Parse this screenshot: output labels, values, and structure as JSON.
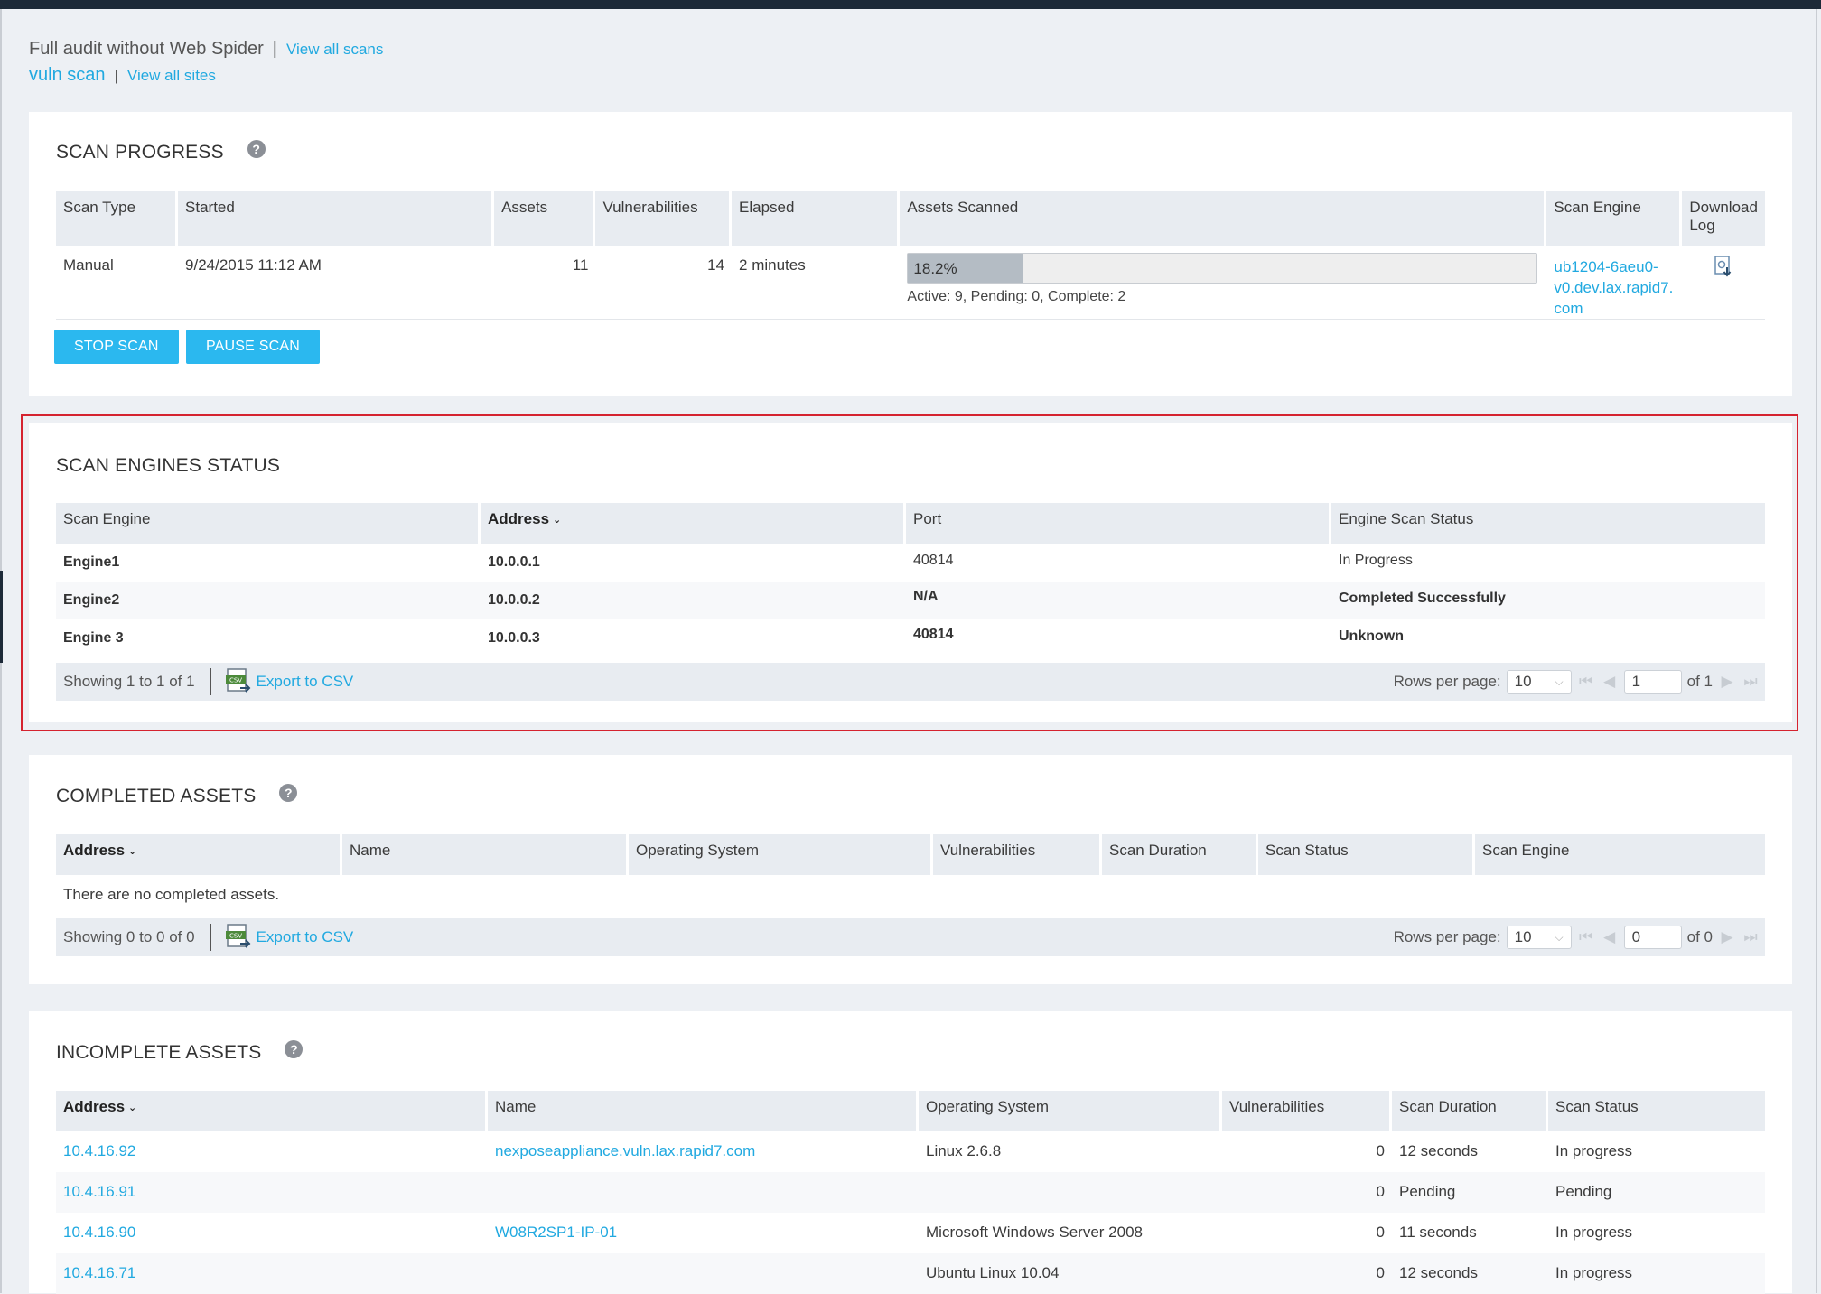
{
  "header": {
    "scan_name": "Full audit without Web Spider",
    "separator": "|",
    "view_all_scans": "View all scans",
    "site_name": "vuln scan",
    "view_all_sites": "View all sites"
  },
  "scan_progress": {
    "title": "SCAN PROGRESS",
    "help": "?",
    "columns": [
      "Scan Type",
      "Started",
      "Assets",
      "Vulnerabilities",
      "Elapsed",
      "Assets Scanned",
      "Scan Engine",
      "Download Log"
    ],
    "row": {
      "scan_type": "Manual",
      "started": "9/24/2015 11:12 AM",
      "assets": "11",
      "vulnerabilities": "14",
      "elapsed": "2 minutes",
      "progress_label": "18.2%",
      "progress_fraction": 0.182,
      "progress_detail": "Active: 9, Pending: 0, Complete: 2",
      "engine_line1": "ub1204-6aeu0-",
      "engine_line2": "v0.dev.lax.rapid7.",
      "engine_line3": "com"
    },
    "stop_label": "STOP SCAN",
    "pause_label": "PAUSE SCAN"
  },
  "engines": {
    "title": "SCAN ENGINES STATUS",
    "columns": [
      "Scan Engine",
      "Address",
      "Port",
      "Engine Scan Status"
    ],
    "rows": [
      {
        "engine": "Engine1",
        "address": "10.0.0.1",
        "port": "40814",
        "status": "In Progress"
      },
      {
        "engine": "Engine2",
        "address": "10.0.0.2",
        "port": "N/A",
        "status": "Completed Successfully"
      },
      {
        "engine": "Engine 3",
        "address": "10.0.0.3",
        "port": "40814",
        "status": "Unknown"
      }
    ],
    "showing": "Showing 1 to 1 of 1",
    "export": "Export to CSV",
    "rows_per_page_label": "Rows per page:",
    "rows_per_page": "10",
    "page": "1",
    "of_pages": "of 1"
  },
  "completed": {
    "title": "COMPLETED ASSETS",
    "help": "?",
    "columns": [
      "Address",
      "Name",
      "Operating System",
      "Vulnerabilities",
      "Scan Duration",
      "Scan Status",
      "Scan Engine"
    ],
    "empty_message": "There are no completed assets.",
    "showing": "Showing 0 to 0 of 0",
    "export": "Export to CSV",
    "rows_per_page_label": "Rows per page:",
    "rows_per_page": "10",
    "page": "0",
    "of_pages": "of 0"
  },
  "incomplete": {
    "title": "INCOMPLETE ASSETS",
    "help": "?",
    "columns": [
      "Address",
      "Name",
      "Operating System",
      "Vulnerabilities",
      "Scan Duration",
      "Scan Status"
    ],
    "rows": [
      {
        "address": "10.4.16.92",
        "name": "nexposeappliance.vuln.lax.rapid7.com",
        "os": "Linux 2.6.8",
        "vulns": "0",
        "duration": "12 seconds",
        "status": "In progress"
      },
      {
        "address": "10.4.16.91",
        "name": "",
        "os": "",
        "vulns": "0",
        "duration": "Pending",
        "status": "Pending"
      },
      {
        "address": "10.4.16.90",
        "name": "W08R2SP1-IP-01",
        "os": "Microsoft Windows Server 2008",
        "vulns": "0",
        "duration": "11 seconds",
        "status": "In progress"
      },
      {
        "address": "10.4.16.71",
        "name": "",
        "os": "Ubuntu Linux 10.04",
        "vulns": "0",
        "duration": "12 seconds",
        "status": "In progress"
      }
    ]
  },
  "icons": {
    "help": "help-icon",
    "download": "download-log-icon",
    "csv": "csv-export-icon",
    "sort": "chevron-down-icon"
  },
  "colors": {
    "accent": "#21a9e0",
    "button": "#2bb8ef",
    "highlight": "#d5232f",
    "topbar": "#1d2a38"
  }
}
